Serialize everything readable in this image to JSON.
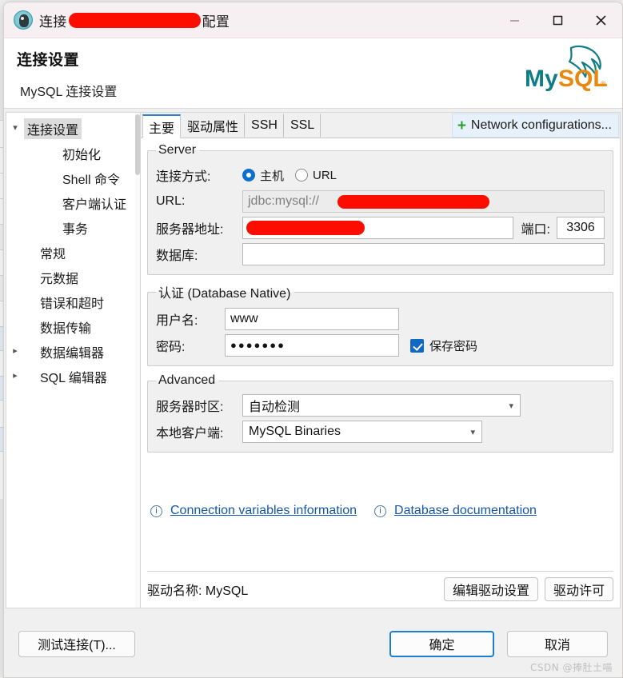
{
  "window": {
    "title_prefix": "连接",
    "title_suffix": "配置",
    "app_icon": "dbeaver-beaver-icon",
    "minimize": "minimize-icon",
    "maximize": "maximize-icon",
    "close": "close-icon"
  },
  "header": {
    "title": "连接设置",
    "subtitle": "MySQL 连接设置",
    "logo_text": "MySQL",
    "logo_colors": {
      "my": "#0f7c86",
      "sql": "#e8880e"
    }
  },
  "sidebar": {
    "items": [
      {
        "label": "连接设置",
        "level": 0,
        "twisty": "down",
        "selected": true
      },
      {
        "label": "初始化",
        "level": 2,
        "twisty": "",
        "selected": false
      },
      {
        "label": "Shell 命令",
        "level": 2,
        "twisty": "",
        "selected": false
      },
      {
        "label": "客户端认证",
        "level": 2,
        "twisty": "",
        "selected": false
      },
      {
        "label": "事务",
        "level": 2,
        "twisty": "",
        "selected": false
      },
      {
        "label": "常规",
        "level": 1,
        "twisty": "",
        "selected": false
      },
      {
        "label": "元数据",
        "level": 1,
        "twisty": "",
        "selected": false
      },
      {
        "label": "错误和超时",
        "level": 1,
        "twisty": "",
        "selected": false
      },
      {
        "label": "数据传输",
        "level": 1,
        "twisty": "",
        "selected": false
      },
      {
        "label": "数据编辑器",
        "level": 1,
        "twisty": "right",
        "selected": false
      },
      {
        "label": "SQL 编辑器",
        "level": 1,
        "twisty": "right",
        "selected": false
      }
    ]
  },
  "tabs": [
    {
      "label": "主要",
      "active": true
    },
    {
      "label": "驱动属性",
      "active": false
    },
    {
      "label": "SSH",
      "active": false
    },
    {
      "label": "SSL",
      "active": false
    }
  ],
  "network_button": {
    "label": "Network configurations...",
    "icon": "plus-icon"
  },
  "server": {
    "legend": "Server",
    "conn_mode_label": "连接方式:",
    "mode_host": "主机",
    "mode_url": "URL",
    "mode_selected": "主机",
    "url_label": "URL:",
    "url_value": "jdbc:mysql://",
    "url_tail": "/",
    "host_label": "服务器地址:",
    "host_value": "",
    "port_label": "端口:",
    "port_value": "3306",
    "db_label": "数据库:",
    "db_value": ""
  },
  "auth": {
    "legend": "认证 (Database Native)",
    "user_label": "用户名:",
    "user_value": "www",
    "password_label": "密码:",
    "password_value": "●●●●●●●",
    "save_password_label": "保存密码",
    "save_password_checked": true
  },
  "advanced": {
    "legend": "Advanced",
    "timezone_label": "服务器时区:",
    "timezone_value": "自动检测",
    "client_label": "本地客户端:",
    "client_value": "MySQL Binaries"
  },
  "links": [
    {
      "label": "Connection variables information",
      "icon": "info-icon"
    },
    {
      "label": "Database documentation",
      "icon": "info-icon"
    }
  ],
  "driver": {
    "name_label": "驱动名称: MySQL",
    "edit_button": "编辑驱动设置",
    "license_button": "驱动许可"
  },
  "footer": {
    "test_button": "测试连接(T)...",
    "ok_button": "确定",
    "cancel_button": "取消"
  },
  "watermark": "CSDN @捧肚土喵"
}
